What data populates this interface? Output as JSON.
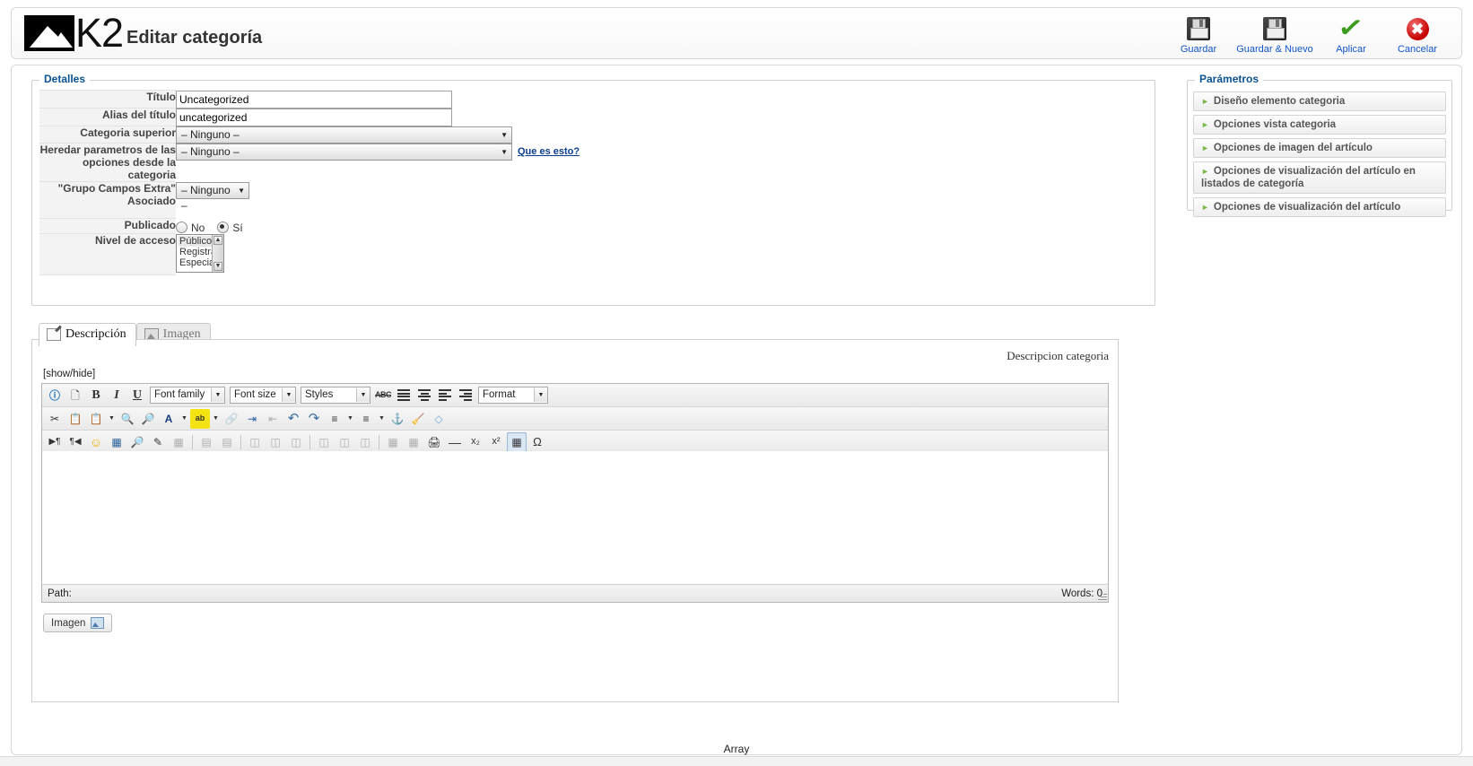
{
  "header": {
    "logo_text": "K2",
    "title": "Editar categoría"
  },
  "toolbar": {
    "buttons": [
      {
        "label": "Guardar",
        "icon": "floppy-disk-icon"
      },
      {
        "label": "Guardar & Nuevo",
        "icon": "floppy-disk-icon"
      },
      {
        "label": "Aplicar",
        "icon": "green-check-icon"
      },
      {
        "label": "Cancelar",
        "icon": "red-x-circle-icon"
      }
    ]
  },
  "details": {
    "legend": "Detalles",
    "fields": {
      "title_label": "Título",
      "title_value": "Uncategorized",
      "alias_label": "Alias del título",
      "alias_value": "uncategorized",
      "parent_label": "Categoria superior",
      "parent_value": "– Ninguno –",
      "inherit_label": "Heredar parametros de las opciones desde la categoria",
      "inherit_value": "– Ninguno –",
      "inherit_help": "Que es esto?",
      "extrafields_label": "\"Grupo Campos Extra\" Asociado",
      "extrafields_value": "– Ninguno –",
      "published_label": "Publicado",
      "published_no": "No",
      "published_yes": "Sí",
      "published_selected": "Sí",
      "access_label": "Nivel de acceso",
      "access_options": [
        "Público",
        "Registrado",
        "Especial"
      ],
      "access_selected": "Público"
    }
  },
  "params": {
    "legend": "Parámetros",
    "items": [
      {
        "label": "Diseño elemento categoria"
      },
      {
        "label": "Opciones vista categoria"
      },
      {
        "label": "Opciones de imagen del artículo"
      },
      {
        "label": "Opciones de visualización del artículo en listados de categoría"
      },
      {
        "label": "Opciones de visualización del artículo"
      }
    ]
  },
  "tabs": [
    {
      "label": "Descripción",
      "icon": "pencil-page-icon",
      "active": true
    },
    {
      "label": "Imagen",
      "icon": "image-icon",
      "active": false
    }
  ],
  "editor": {
    "caption": "Descripcion categoria",
    "showhide": "[show/hide]",
    "content": "",
    "path_label": "Path:",
    "words_label": "Words: 0",
    "image_button": "Imagen",
    "selects": {
      "font_family": "Font family",
      "font_size": "Font size",
      "styles": "Styles",
      "format": "Format"
    },
    "row1_icons": [
      "help-icon",
      "new-document-icon",
      "bold-icon",
      "italic-icon",
      "underline-icon",
      "strikethrough-icon",
      "align-justify-icon",
      "align-center-icon",
      "align-left-icon",
      "align-right-icon"
    ],
    "row2_icons": [
      "cut-icon",
      "copy-icon",
      "paste-icon",
      "find-icon",
      "find-replace-icon",
      "text-color-icon",
      "background-color-icon",
      "unlink-icon",
      "indent-icon",
      "outdent-icon",
      "undo-icon",
      "redo-icon",
      "numbered-list-icon",
      "bullet-list-icon",
      "anchor-icon",
      "cleanup-icon",
      "remove-format-icon"
    ],
    "row3_icons": [
      "ltr-icon",
      "rtl-icon",
      "emoticon-icon",
      "media-icon",
      "preview-icon",
      "edit-source-icon",
      "delete-table-icon",
      "insert-row-icon",
      "delete-row-icon",
      "print-icon",
      "horizontal-rule-icon",
      "subscript-icon",
      "superscript-icon",
      "insert-table-icon",
      "special-character-icon"
    ],
    "row4_icons": [
      "font-select-icon",
      "broken-image-icon",
      "pilcrow-icon",
      "blockquote-icon",
      "abbr-icon",
      "acronym-icon",
      "text-style-icon",
      "text-color-alt-icon",
      "attachment-icon",
      "image-insert-icon",
      "link-icon",
      "spellcheck-icon",
      "code-icon",
      "page-break-icon",
      "layer-icon"
    ]
  },
  "footer": {
    "array_text": "Array"
  },
  "colors": {
    "legend_blue": "#0b5394",
    "link_blue": "#1155cc",
    "accent_green": "#7ab648",
    "label_gray": "#444444"
  }
}
